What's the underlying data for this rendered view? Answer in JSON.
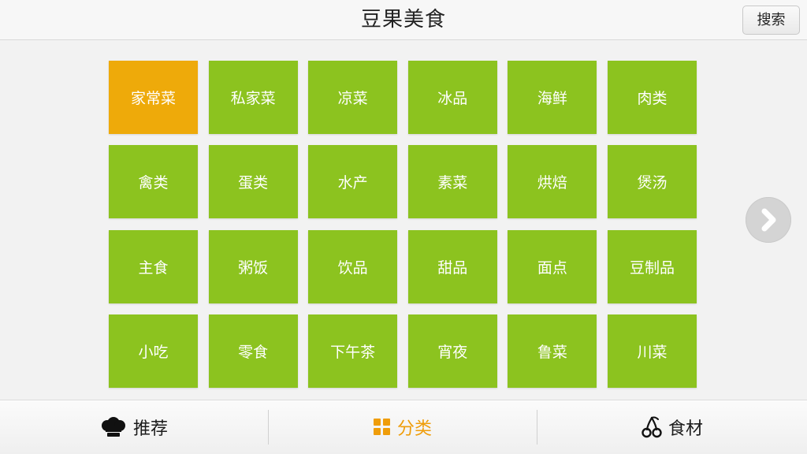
{
  "header": {
    "title": "豆果美食",
    "search_label": "搜索"
  },
  "categories": [
    "家常菜",
    "私家菜",
    "凉菜",
    "冰品",
    "海鲜",
    "肉类",
    "禽类",
    "蛋类",
    "水产",
    "素菜",
    "烘焙",
    "煲汤",
    "主食",
    "粥饭",
    "饮品",
    "甜品",
    "面点",
    "豆制品",
    "小吃",
    "零食",
    "下午茶",
    "宵夜",
    "鲁菜",
    "川菜"
  ],
  "selected_category": "家常菜",
  "bottom_nav": {
    "tabs": [
      {
        "label": "推荐",
        "icon": "chef-hat-icon"
      },
      {
        "label": "分类",
        "icon": "grid-icon"
      },
      {
        "label": "食材",
        "icon": "cherries-icon"
      }
    ],
    "active_tab": "分类"
  },
  "colors": {
    "tile_green": "#8cc31f",
    "tile_selected": "#eeaa0a",
    "accent": "#ef9d0a"
  }
}
